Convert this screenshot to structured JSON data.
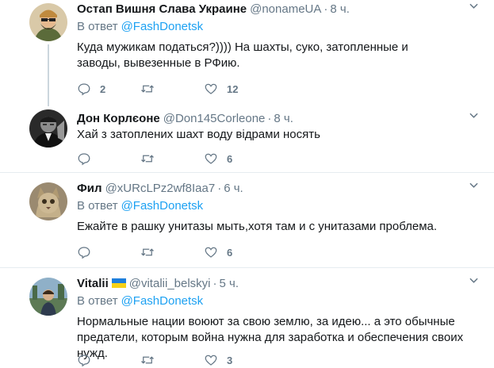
{
  "reply_prefix": "В ответ",
  "tweets": [
    {
      "name": "Остап Вишня Слава Украине",
      "handle": "@nonameUA",
      "time": "8 ч.",
      "reply_to": "@FashDonetsk",
      "text": "Куда мужикам податься?)))) На шахты, суко, затопленные и заводы, вывезенные в РФию.",
      "replies": "2",
      "retweets": "",
      "likes": "12"
    },
    {
      "name": "Дон Корлєоне",
      "handle": "@Don145Corleone",
      "time": "8 ч.",
      "text": "Хай з затоплених шахт воду відрами носять",
      "replies": "",
      "retweets": "",
      "likes": "6"
    },
    {
      "name": "Фил",
      "handle": "@xURcLPz2wf8Iaa7",
      "time": "6 ч.",
      "reply_to": "@FashDonetsk",
      "text": "Ежайте в рашку унитазы мыть,хотя там и с унитазами проблема.",
      "replies": "",
      "retweets": "",
      "likes": "6"
    },
    {
      "name": "Vitalii",
      "handle": "@vitalii_belskyi",
      "time": "5 ч.",
      "reply_to": "@FashDonetsk",
      "text": "Нормальные нации воюют за свою землю, за идею... а это обычные предатели, которым война нужна для заработка и обеспечения своих нужд.",
      "replies": "",
      "retweets": "",
      "likes": "3"
    }
  ],
  "colors": {
    "link": "#1da1f2",
    "muted": "#657786",
    "separator": "#e6ecf0",
    "thread_line": "#ccd6dd"
  },
  "icons": [
    "reply-icon",
    "retweet-icon",
    "like-icon",
    "chevron-down-icon",
    "ukraine-flag-icon"
  ]
}
